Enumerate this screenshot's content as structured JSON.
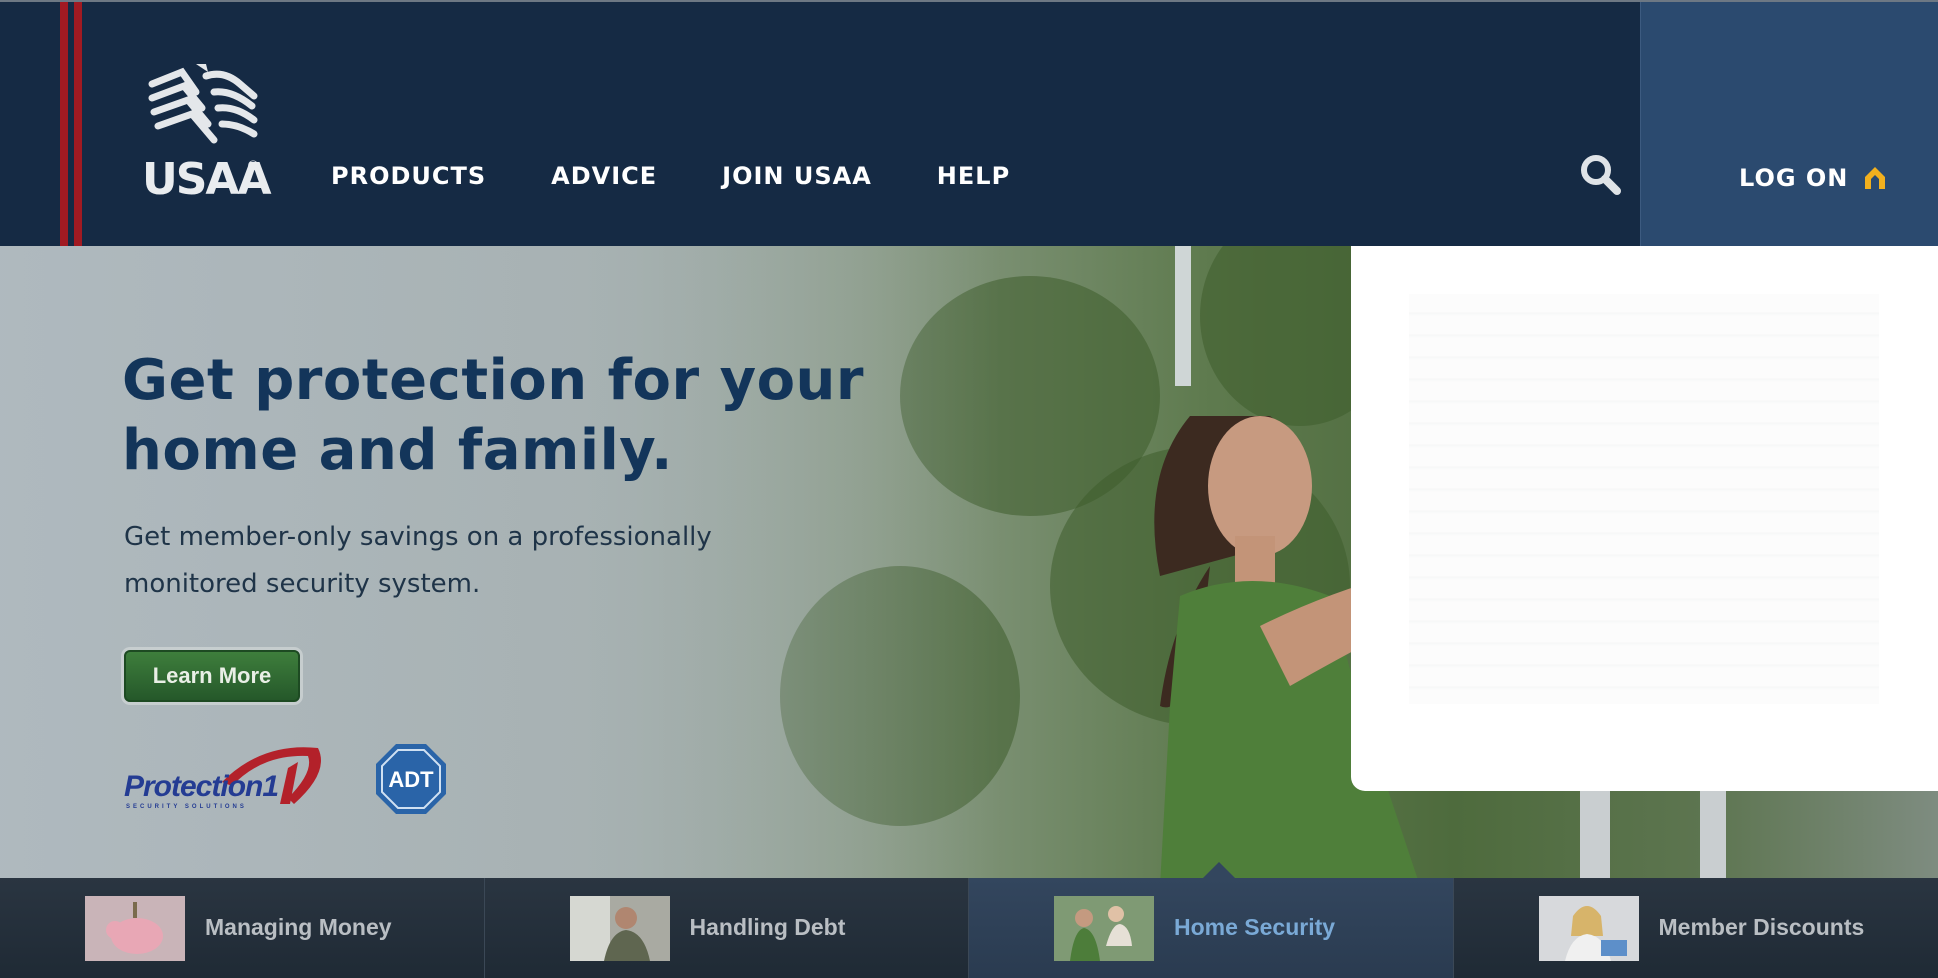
{
  "header": {
    "logo_text": "USAA",
    "logo_reg": "®",
    "nav": [
      "PRODUCTS",
      "ADVICE",
      "JOIN USAA",
      "HELP"
    ],
    "search_icon": "search-icon",
    "logon_label": "LOG ON",
    "logon_icon": "lock-icon"
  },
  "hero": {
    "headline": "Get protection for your home and family.",
    "subtext": "Get member-only savings on a professionally monitored security system.",
    "cta_label": "Learn More",
    "partners": [
      "Protection1",
      "ADT"
    ],
    "partner_sub": "SECURITY SOLUTIONS"
  },
  "tabs": [
    {
      "label": "Managing Money",
      "active": false
    },
    {
      "label": "Handling Debt",
      "active": false
    },
    {
      "label": "Home Security",
      "active": true
    },
    {
      "label": "Member Discounts",
      "active": false
    }
  ],
  "colors": {
    "header_bg": "#152a44",
    "stripe": "#a11a22",
    "logon_bg": "#2b4a6f",
    "lock_accent": "#f2b01e",
    "cta_green": "#2f6b30",
    "active_tab_text": "#7aa9d6"
  }
}
